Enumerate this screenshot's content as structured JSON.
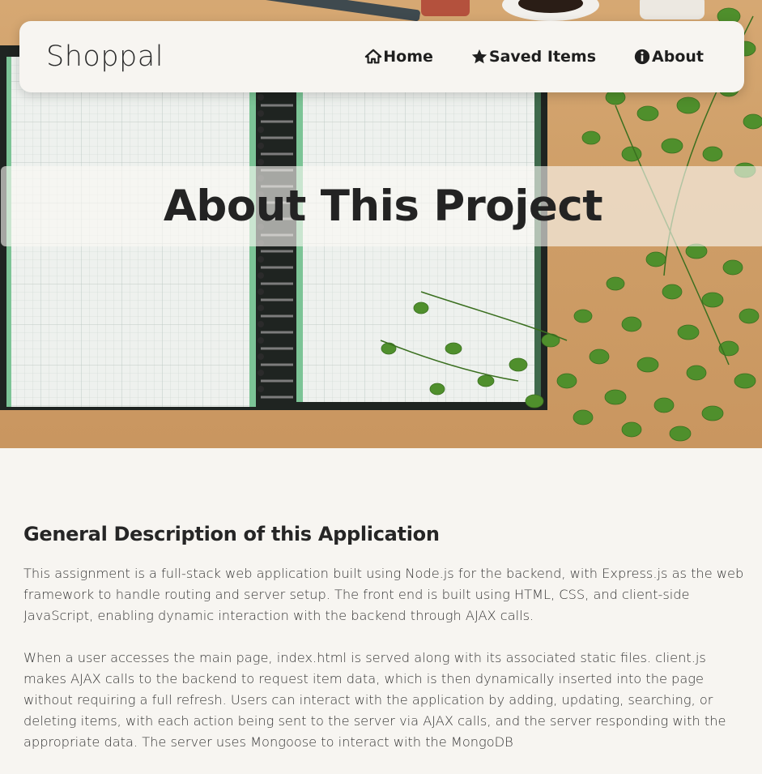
{
  "nav": {
    "brand": "Shoppal",
    "links": [
      {
        "label": "Home",
        "icon": "home-icon"
      },
      {
        "label": "Saved Items",
        "icon": "star-icon"
      },
      {
        "label": "About",
        "icon": "info-icon"
      }
    ]
  },
  "hero": {
    "title": "About This Project"
  },
  "main": {
    "heading": "General Description of this Application",
    "paragraphs": [
      "This assignment is a full-stack web application built using Node.js for the backend, with Express.js as the web framework to handle routing and server setup. The front end is built using HTML, CSS, and client-side JavaScript, enabling dynamic interaction with the backend through AJAX calls.",
      "When a user accesses the main page, index.html is served along with its associated static files. client.js makes AJAX calls to the backend to request item data, which is then dynamically inserted into the page without requiring a full refresh. Users can interact with the application by adding, updating, searching, or deleting items, with each action being sent to the server via AJAX calls, and the server responding with the appropriate data. The server uses Mongoose to interact with the MongoDB"
    ]
  },
  "colors": {
    "page_bg": "#f7f5f1",
    "navbar_bg": "#f7f5f1",
    "text": "#2c2c2c",
    "wood": "#d2a46e",
    "leaf": "#4f8f2c"
  }
}
